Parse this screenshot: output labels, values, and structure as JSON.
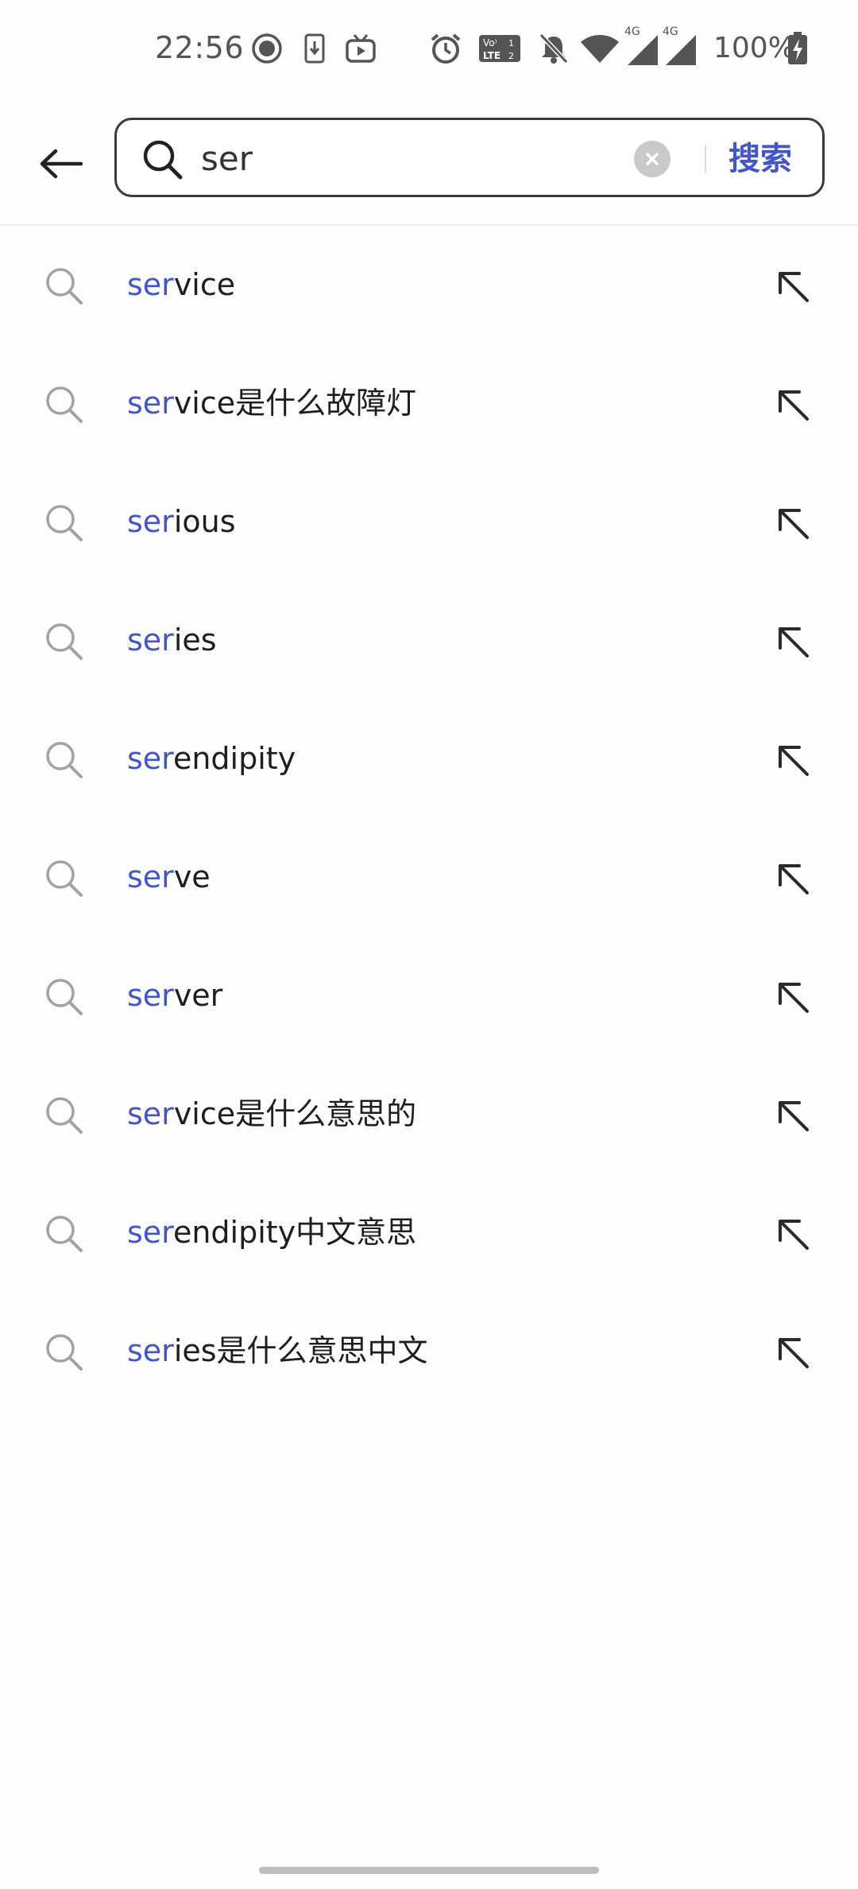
{
  "status_bar": {
    "time": "22:56",
    "battery": "100%",
    "icons": [
      "record-icon",
      "download-icon",
      "tv-icon",
      "alarm-icon",
      "volte-icon",
      "mute-icon",
      "wifi-icon",
      "signal-4g-icon",
      "signal-4g-icon",
      "battery-charging-icon"
    ],
    "network_labels": [
      "4G",
      "4G"
    ]
  },
  "header": {
    "search": {
      "value": "ser",
      "placeholder": ""
    },
    "search_button_label": "搜索"
  },
  "colors": {
    "accent": "#4356c9",
    "text": "#1e1e1e",
    "icon_gray": "#9a9a9a"
  },
  "suggestions": [
    {
      "match": "ser",
      "rest": "vice"
    },
    {
      "match": "ser",
      "rest": "vice是什么故障灯"
    },
    {
      "match": "ser",
      "rest": "ious"
    },
    {
      "match": "ser",
      "rest": "ies"
    },
    {
      "match": "ser",
      "rest": "endipity"
    },
    {
      "match": "ser",
      "rest": "ve"
    },
    {
      "match": "ser",
      "rest": "ver"
    },
    {
      "match": "ser",
      "rest": "vice是什么意思的"
    },
    {
      "match": "ser",
      "rest": "endipity中文意思"
    },
    {
      "match": "ser",
      "rest": "ies是什么意思中文"
    }
  ]
}
